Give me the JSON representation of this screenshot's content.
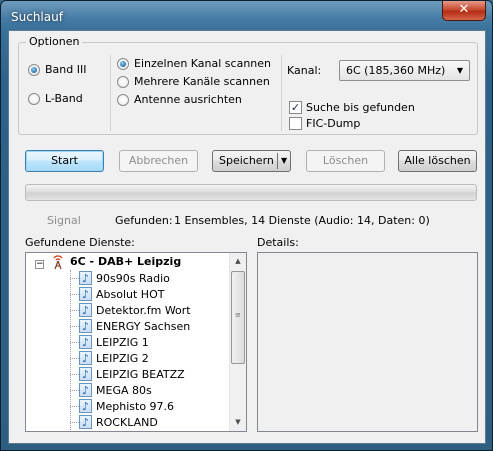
{
  "window": {
    "title": "Suchlauf",
    "close_glyph": "✕"
  },
  "options": {
    "group_label": "Optionen",
    "band_iii": "Band III",
    "l_band": "L-Band",
    "scan_single": "Einzelnen Kanal scannen",
    "scan_multiple": "Mehrere Kanäle scannen",
    "align_antenna": "Antenne ausrichten",
    "channel_label": "Kanal:",
    "channel_value": "6C (185,360 MHz)",
    "search_until_found": "Suche bis gefunden",
    "search_until_found_checked": true,
    "fic_dump": "FIC-Dump",
    "fic_dump_checked": false
  },
  "buttons": {
    "start": "Start",
    "cancel": "Abbrechen",
    "save": "Speichern",
    "delete": "Löschen",
    "delete_all": "Alle löschen"
  },
  "progress": {
    "fraction": 0.0
  },
  "status": {
    "signal": "Signal",
    "found_label": "Gefunden:",
    "found_value": "1 Ensembles, 14 Dienste (Audio: 14, Daten: 0)"
  },
  "services": {
    "label": "Gefundene Dienste:",
    "ensemble": "6C - DAB+ Leipzig",
    "items": [
      "90s90s Radio",
      "Absolut HOT",
      "Detektor.fm Wort",
      "ENERGY Sachsen",
      "LEIPZIG 1",
      "LEIPZIG 2",
      "LEIPZIG BEATZZ",
      "MEGA 80s",
      "Mephisto 97.6",
      "ROCKLAND"
    ]
  },
  "details": {
    "label": "Details:"
  },
  "icons": {
    "ensemble": "radio-tower-icon",
    "service": "music-note-icon",
    "note_glyph": "♪",
    "collapse_glyph": "−",
    "scroll_up": "▲",
    "scroll_down": "▼",
    "dropdown": "▼",
    "grip": "≡"
  },
  "colors": {
    "accent": "#1b5f9c",
    "progress": "#4fb04f",
    "titlebar": "#2e6188"
  }
}
